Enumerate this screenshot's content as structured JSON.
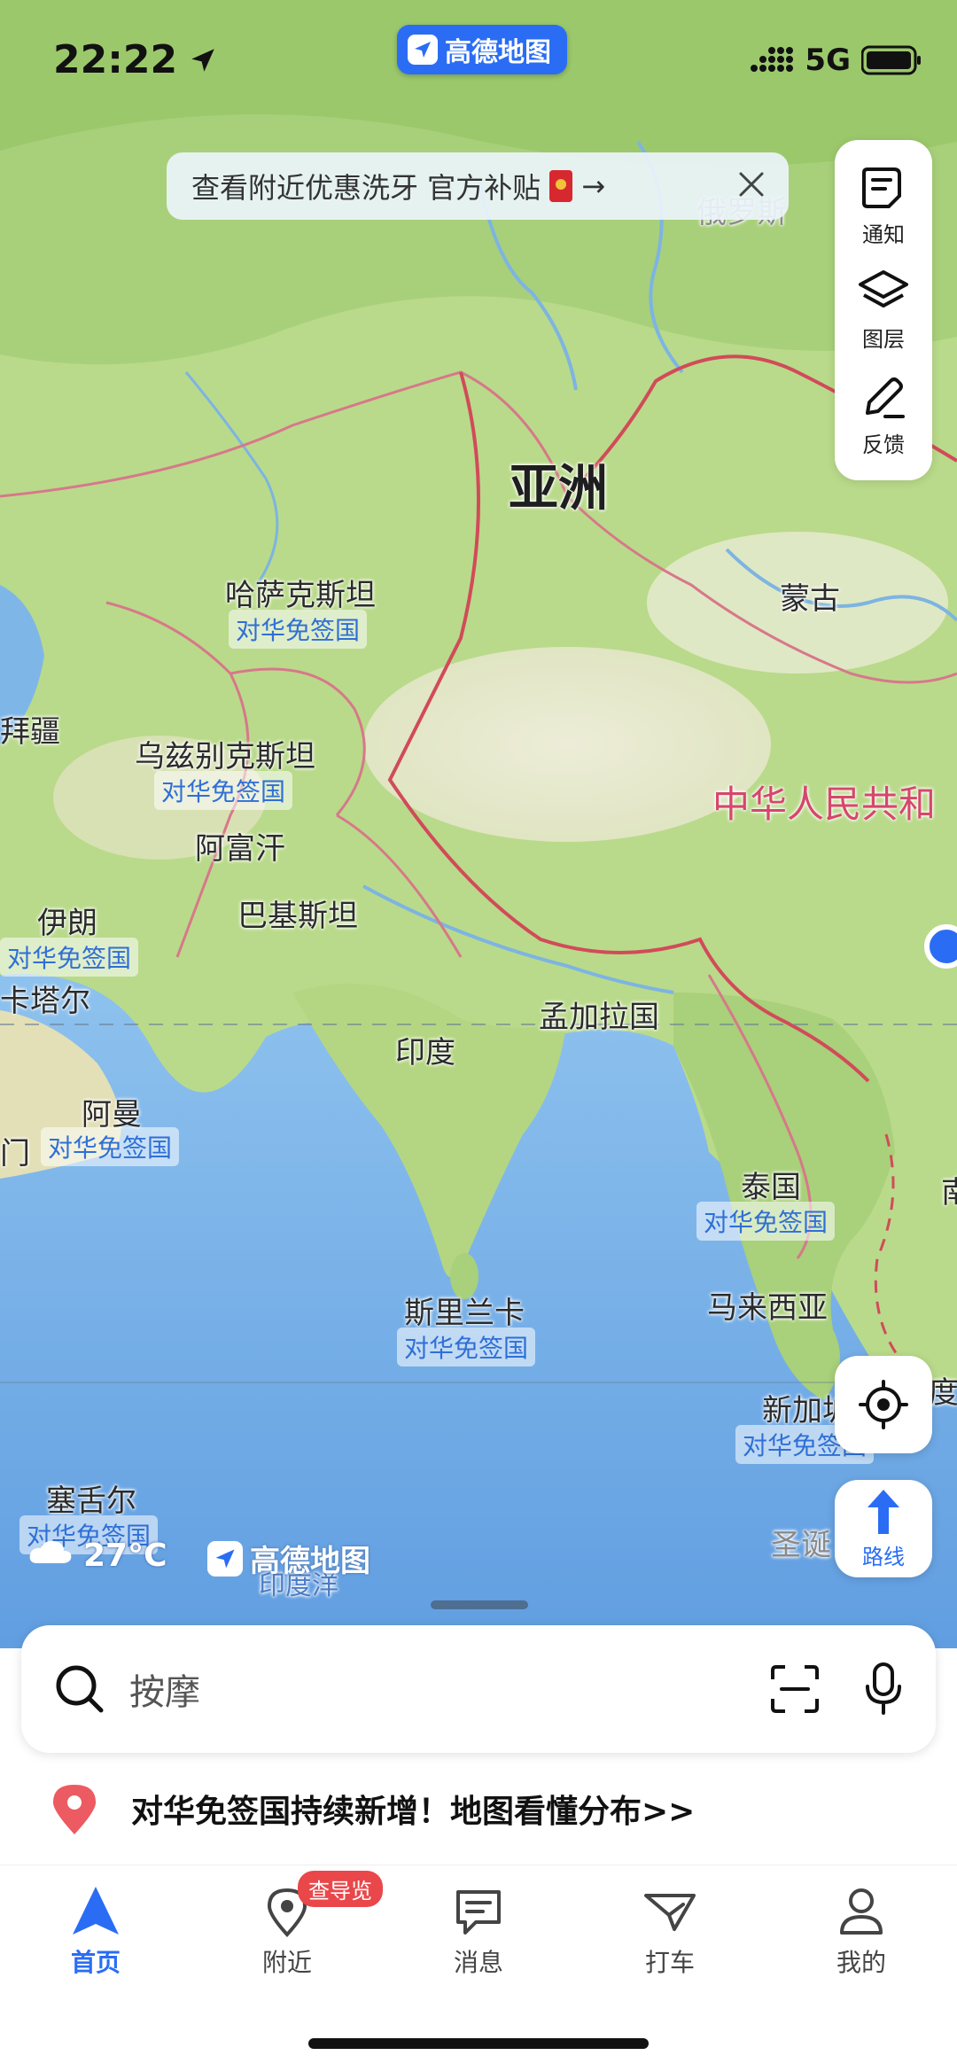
{
  "status": {
    "time": "22:22",
    "network": "5G",
    "brand": "高德地图"
  },
  "promo": {
    "text": "查看附近优惠洗牙 官方补贴",
    "arrow": "→"
  },
  "side_panel": {
    "notice": "通知",
    "layers": "图层",
    "feedback": "反馈"
  },
  "route_label": "路线",
  "map": {
    "continent": "亚洲",
    "visa_tag": "对华免签国",
    "countries": {
      "russia": "俄罗斯",
      "mongolia": "蒙古",
      "kazakhstan": "哈萨克斯坦",
      "uzbekistan": "乌兹别克斯坦",
      "afghanistan": "阿富汗",
      "pakistan": "巴基斯坦",
      "iran": "伊朗",
      "qatar": "卡塔尔",
      "oman": "阿曼",
      "india": "印度",
      "bangladesh": "孟加拉国",
      "thailand": "泰国",
      "srilanka": "斯里兰卡",
      "malaysia": "马来西亚",
      "singapore": "新加坡",
      "seychelles": "塞舌尔",
      "china": "中华人民共和",
      "azerbaijan": "拜疆",
      "indian_ocean": "印度洋",
      "christmas": "圣诞",
      "yemen": "门",
      "south": "南",
      "indonesia": "度"
    },
    "weather": "27°C",
    "watermark": "高德地图"
  },
  "search": {
    "placeholder": "按摩"
  },
  "news": "对华免签国持续新增！地图看懂分布>>",
  "tabs": [
    {
      "label": "首页"
    },
    {
      "label": "附近",
      "badge": "查导览"
    },
    {
      "label": "消息"
    },
    {
      "label": "打车"
    },
    {
      "label": "我的"
    }
  ],
  "colors": {
    "accent": "#2a6df4",
    "china_label": "#d6476a",
    "badge": "#e9474a"
  }
}
